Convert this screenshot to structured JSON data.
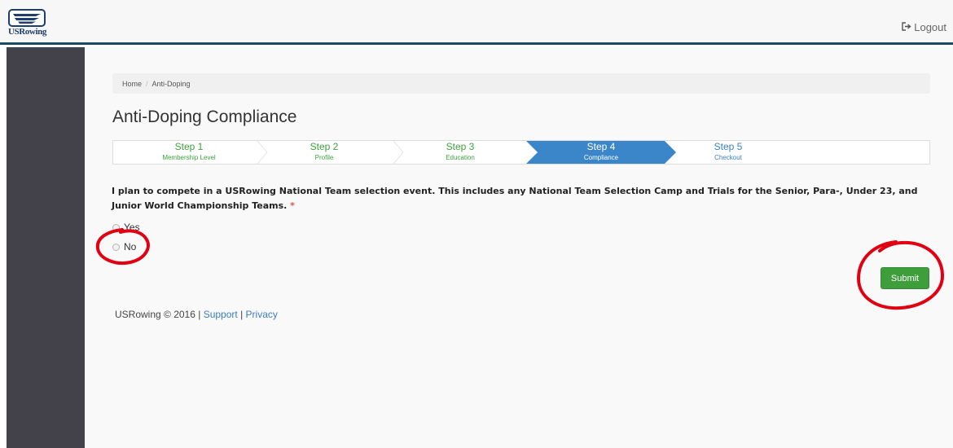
{
  "header": {
    "logo_text": "USRowing",
    "logout_label": "Logout"
  },
  "breadcrumb": {
    "items": [
      "Home",
      "Anti-Doping"
    ],
    "separator": "/"
  },
  "page": {
    "title": "Anti-Doping Compliance"
  },
  "steps": [
    {
      "title": "Step 1",
      "subtitle": "Membership Level",
      "state": "completed"
    },
    {
      "title": "Step 2",
      "subtitle": "Profile",
      "state": "completed"
    },
    {
      "title": "Step 3",
      "subtitle": "Education",
      "state": "completed"
    },
    {
      "title": "Step 4",
      "subtitle": "Compliance",
      "state": "active"
    },
    {
      "title": "Step 5",
      "subtitle": "Checkout",
      "state": "upcoming"
    }
  ],
  "form": {
    "question": "I plan to compete in a USRowing National Team selection event. This includes any National Team Selection Camp and Trials for the Senior, Para-, Under 23, and Junior World Championship Teams.",
    "required_marker": "*",
    "options": [
      "Yes",
      "No"
    ],
    "submit_label": "Submit"
  },
  "footer": {
    "copyright": "USRowing © 2016 |",
    "support_label": "Support",
    "divider": "|",
    "privacy_label": "Privacy"
  },
  "colors": {
    "header_border": "#1d4a63",
    "sidebar": "#43424b",
    "active_step": "#3b86c8",
    "completed_step_text": "#3ea23e",
    "submit_button": "#3f9e3c",
    "annotation_circle": "#e00012"
  },
  "icons": {
    "logout": "logout-icon",
    "logo": "usrowing-logo"
  }
}
